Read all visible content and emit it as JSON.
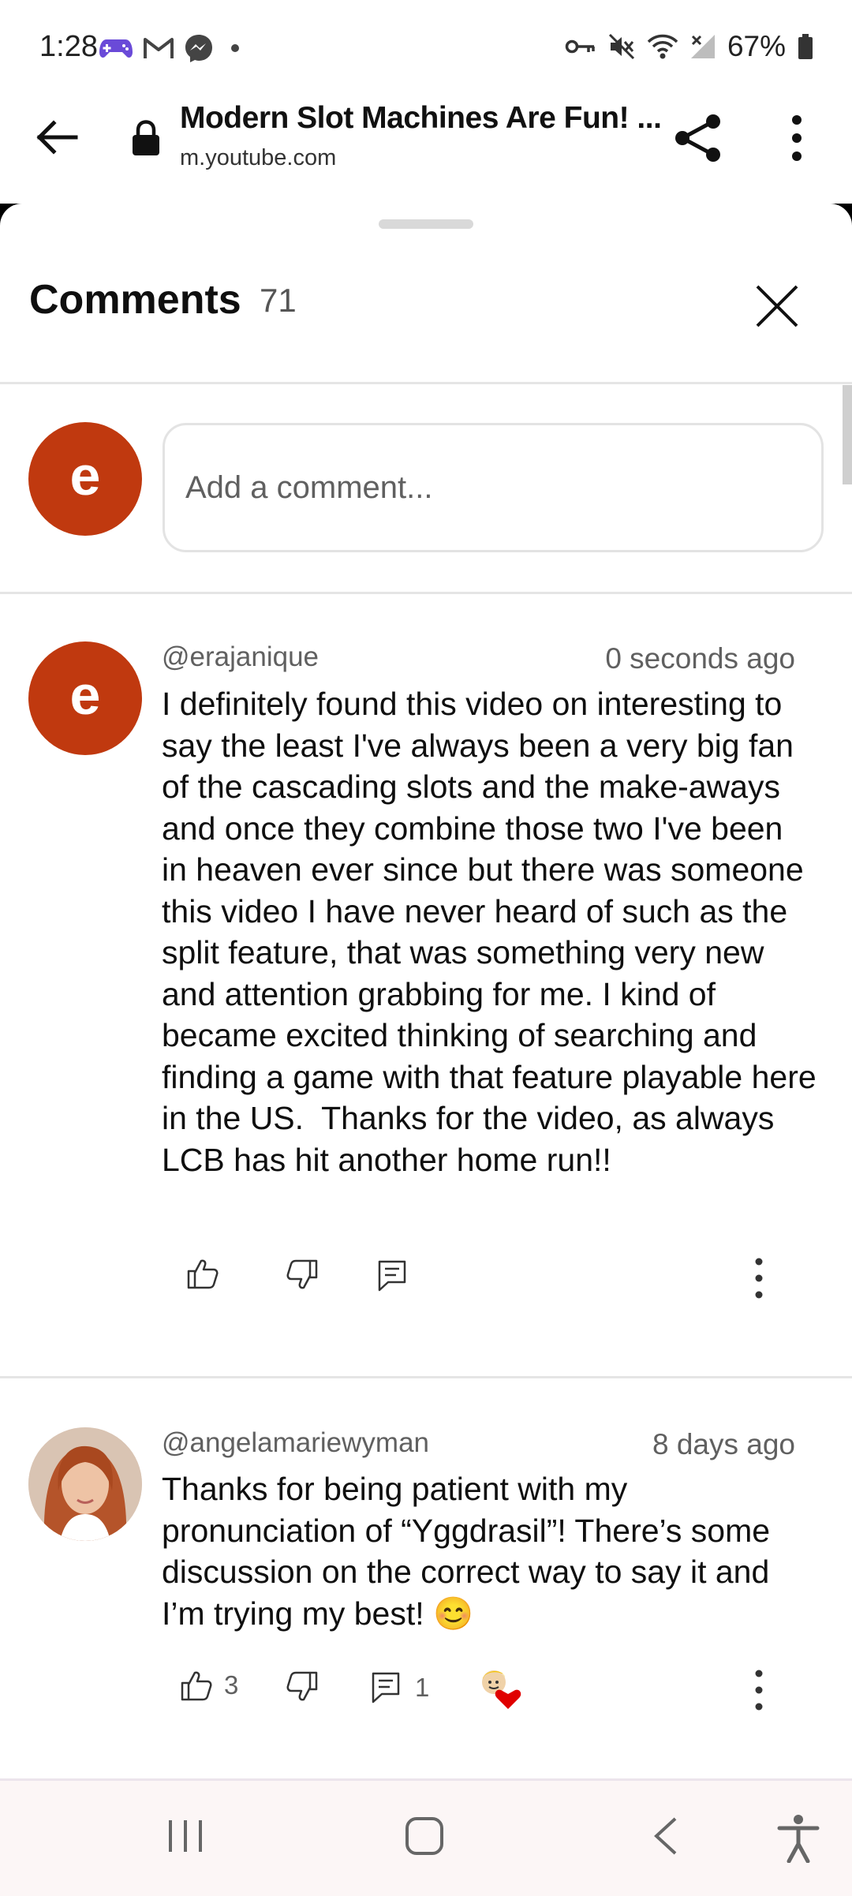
{
  "status_bar": {
    "time": "1:28",
    "app_icons": [
      "gamepad-icon",
      "gmail-icon",
      "messenger-icon",
      "dot-icon"
    ],
    "system_icons": [
      "vpn-key-icon",
      "mute-icon",
      "wifi-icon",
      "no-signal-icon",
      "battery-icon"
    ],
    "battery": "67%"
  },
  "browser": {
    "title": "Modern Slot Machines Are Fun! ...",
    "url": "m.youtube.com"
  },
  "comments_panel": {
    "title": "Comments",
    "count": "71",
    "input_placeholder": "Add a comment...",
    "user_initial": "e",
    "accent_color": "#c0390f"
  },
  "comments": [
    {
      "author": "@erajanique",
      "time": "0 seconds ago",
      "avatar_initial": "e",
      "text": "I definitely found this video on interesting to say the least I've always been a very big fan of the cascading slots and the make-aways and once they combine those two I've been in heaven ever since but there was someone this video I have never heard of such as the split feature, that was something very new and attention grabbing for me. I kind of became excited thinking of searching and finding a game with that feature playable here in the US.  Thanks for the video, as always LCB has hit another home run!!",
      "likes": "",
      "replies": ""
    },
    {
      "author": "@angelamariewyman",
      "time": "8 days ago",
      "avatar": "photo-avatar",
      "text": "Thanks for being patient with my pronunciation of “Yggdrasil”! There’s some discussion on the correct way to say it and I’m trying my best! 😊",
      "likes": "3",
      "replies": "1",
      "creator_heart": "creator-heart-icon"
    }
  ],
  "nav_bar": {
    "buttons": [
      "recents-icon",
      "home-icon",
      "back-icon",
      "accessibility-icon"
    ]
  }
}
